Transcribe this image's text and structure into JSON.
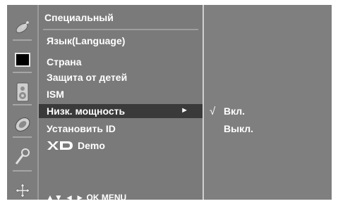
{
  "iconbar": {
    "icons": [
      "satellite-dish-icon",
      "screen-icon",
      "speaker-icon",
      "disc-icon",
      "magnifier-icon",
      "cross-arrows-icon"
    ]
  },
  "menu": {
    "title": "Специальный",
    "items": [
      {
        "label": "Язык(Language)"
      },
      {
        "label": "Страна"
      },
      {
        "label": "Защита от детей"
      },
      {
        "label": "ISM"
      },
      {
        "label": "Низк. мощность",
        "selected": true,
        "arrow": "►"
      },
      {
        "label": "Установить ID"
      },
      {
        "label": "Demo",
        "logo": "XD"
      }
    ],
    "footer": "▲▼ ◄ ► OK MENU"
  },
  "submenu": {
    "items": [
      {
        "label": "Вкл.",
        "check": "√"
      },
      {
        "label": "Выкл."
      }
    ]
  },
  "colors": {
    "panel": "#7a7a7a",
    "selected": "#3a3a3a",
    "text": "#ffffff"
  }
}
